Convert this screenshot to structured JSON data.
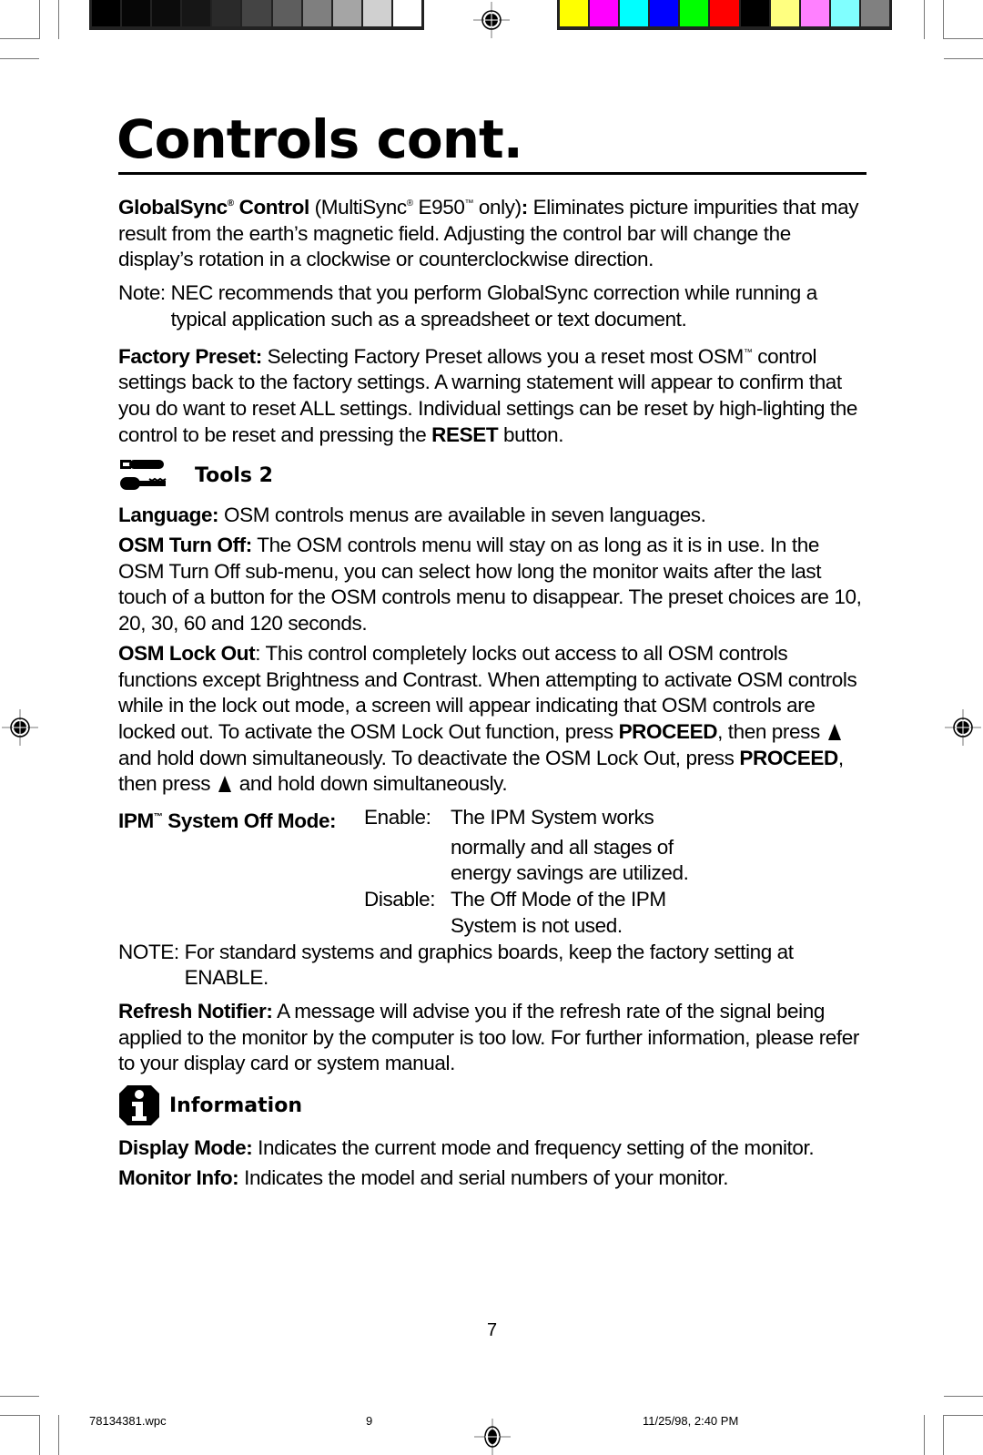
{
  "print_marks": {
    "grayscale_swatches": [
      "#000000",
      "#060606",
      "#0c0c0c",
      "#161616",
      "#2a2a2a",
      "#444444",
      "#5e5e5e",
      "#7f7f7f",
      "#a5a5a5",
      "#d0d0d0",
      "#ffffff"
    ],
    "color_swatches": [
      "#ffff00",
      "#ff00ff",
      "#00ffff",
      "#0000ff",
      "#00ff00",
      "#ff0000",
      "#000000",
      "#ffff80",
      "#ff80ff",
      "#80ffff",
      "#808080"
    ]
  },
  "page": {
    "title": "Controls cont.",
    "globalsync": {
      "label": "GlobalSync",
      "label_mark": "®",
      "label_suffix": " Control",
      "paren_open": " (MultiSync",
      "paren_mark": "®",
      "paren_model": " E950",
      "paren_tm": "™",
      "paren_close": " only)",
      "colon": ":",
      "text": " Eliminates picture impurities that may result from the earth’s magnetic field. Adjusting the control bar will change the display’s rotation in a clockwise or counterclockwise direction."
    },
    "globalsync_note": {
      "label": "Note: ",
      "text": "NEC recommends that you perform GlobalSync correction while running a typical application such as a spreadsheet or text document."
    },
    "factory_preset": {
      "label": "Factory Preset:",
      "text1": " Selecting Factory Preset allows you a reset most OSM",
      "tm": "™",
      "text2": " control settings back to the factory settings. A warning statement will appear to confirm that you do want to reset ALL settings. Individual settings can be reset by high-lighting the control to be reset and pressing the ",
      "reset": "RESET",
      "text3": " button."
    },
    "tools2": {
      "icon": "wrench-screwdriver-icon",
      "title": "Tools 2",
      "language": {
        "label": "Language:",
        "text": " OSM controls menus are available in seven languages."
      },
      "osm_turn_off": {
        "label": "OSM Turn Off:",
        "text": " The OSM controls menu will stay on as long as it is in use.  In the OSM Turn Off sub-menu, you can select how long the monitor waits after the last touch of a button for the OSM controls menu to disappear. The preset choices are 10, 20, 30, 60 and 120 seconds."
      },
      "osm_lock_out": {
        "label": "OSM Lock Out",
        "text1": ": This control completely locks out access to all OSM controls functions except Brightness and Contrast. When attempting to activate OSM controls while in the lock out mode, a screen will appear indicating that OSM controls are locked out. To activate the OSM Lock Out function, press ",
        "proceed1": "PROCEED",
        "text2": ", then press ",
        "text3": " and hold down simultaneously. To deactivate the OSM Lock Out, press ",
        "proceed2": "PROCEED",
        "text4": ", then press ",
        "text5": " and hold down simultaneously."
      },
      "ipm": {
        "label": "IPM",
        "tm": "™",
        "label_suffix": " System Off Mode:",
        "enable_label": "Enable:",
        "enable_lines": [
          "The IPM System works",
          "normally and all stages of",
          "energy savings are utilized."
        ],
        "disable_label": "Disable:",
        "disable_lines": [
          "The Off Mode of the IPM",
          "System is not used."
        ]
      },
      "ipm_note": {
        "label": "NOTE: ",
        "text": "For standard systems and graphics boards, keep the factory setting at ENABLE."
      },
      "refresh_notifier": {
        "label": "Refresh Notifier:",
        "text": " A message will advise you if the refresh rate of the signal being applied to the monitor by the computer is too low. For further information, please refer to your display card or system manual."
      }
    },
    "information": {
      "icon": "info-icon",
      "title": "Information",
      "display_mode": {
        "label": "Display Mode:",
        "text": " Indicates the current mode and frequency setting of the monitor."
      },
      "monitor_info": {
        "label": "Monitor Info:",
        "text": " Indicates the model and serial numbers of your monitor."
      }
    },
    "page_number": "7"
  },
  "footer": {
    "filename": "78134381.wpc",
    "sheet": "9",
    "timestamp": "11/25/98, 2:40 PM"
  }
}
